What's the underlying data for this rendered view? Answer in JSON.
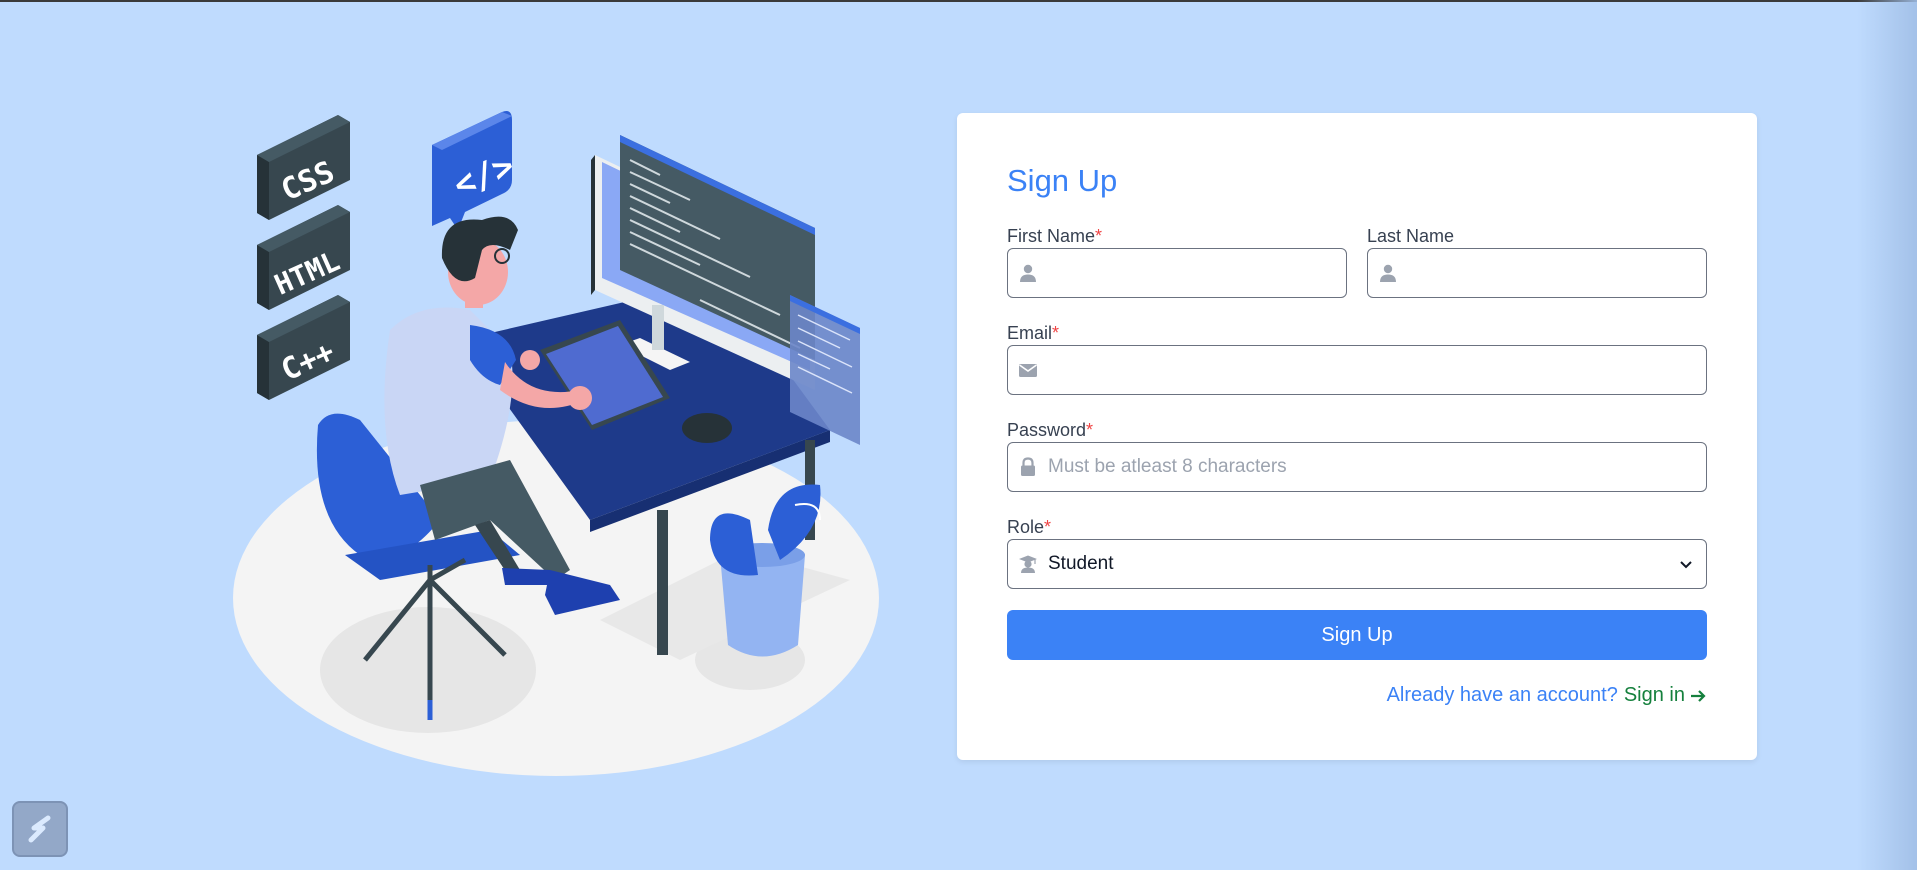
{
  "form": {
    "title": "Sign Up",
    "first_name_label": "First Name",
    "last_name_label": "Last Name",
    "email_label": "Email",
    "password_label": "Password",
    "password_placeholder": "Must be atleast 8 characters",
    "role_label": "Role",
    "role_value": "Student",
    "required_mark": "*",
    "submit_label": "Sign Up",
    "have_account_text": "Already have an account?",
    "signin_label": "Sign in"
  },
  "illustration": {
    "tags": [
      "CSS",
      "HTML",
      "C++"
    ],
    "code_bubble": "</>"
  },
  "icons": {
    "first_name": "user-icon",
    "last_name": "user-icon",
    "email": "envelope-icon",
    "password": "lock-icon",
    "role": "graduate-icon",
    "signin_arrow": "arrow-right-icon",
    "badge": "app-badge-icon"
  },
  "colors": {
    "background": "#bfdbfe",
    "accent": "#3b82f6",
    "link_green": "#15803d",
    "required": "#ef4444"
  }
}
